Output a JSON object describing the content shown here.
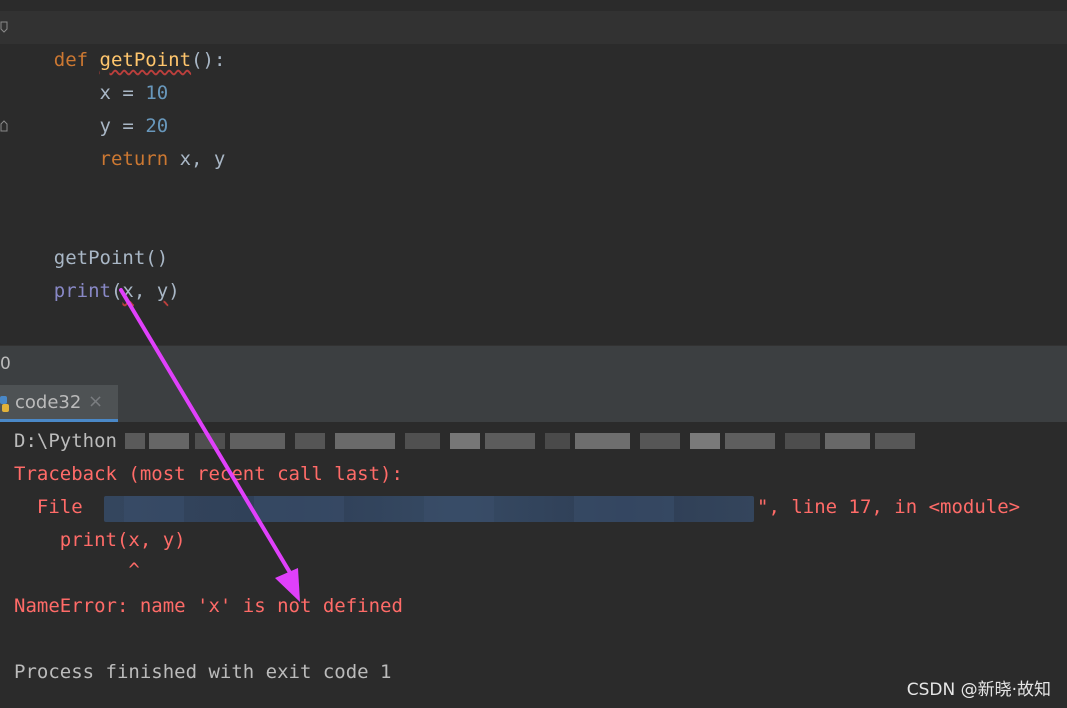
{
  "editor": {
    "lines": [
      {
        "kw": "def",
        "sp": " ",
        "fn": "getPoint",
        "rest": "():"
      },
      {
        "indent": "    ",
        "var": "x",
        "op": " = ",
        "num": "10"
      },
      {
        "indent": "    ",
        "var": "y",
        "op": " = ",
        "num": "20"
      },
      {
        "indent": "    ",
        "kw": "return",
        "rest": " x, y"
      },
      {
        "call": "getPoint()"
      },
      {
        "builtin": "print",
        "open": "(",
        "a": "x",
        "comma": ", ",
        "b": "y",
        "close": ")"
      }
    ]
  },
  "breadcrumb": {
    "text": "0"
  },
  "run_tab": {
    "label": "code32",
    "close": "×"
  },
  "console": {
    "cmd_prefix": "D:\\Python",
    "traceback": "Traceback (most recent call last):",
    "file_prefix": "  File ",
    "file_suffix": "\", line 17, in <module>",
    "code_line": "    print(x, y)",
    "caret": "          ^",
    "error": "NameError: name 'x' is not defined",
    "process": "Process finished with exit code 1"
  },
  "watermark": {
    "text": "CSDN @新晓·故知"
  },
  "colors": {
    "keyword": "#cc7832",
    "function": "#ffc66d",
    "number": "#6897bb",
    "error": "#ff6b68",
    "arrow": "#e040fb"
  }
}
